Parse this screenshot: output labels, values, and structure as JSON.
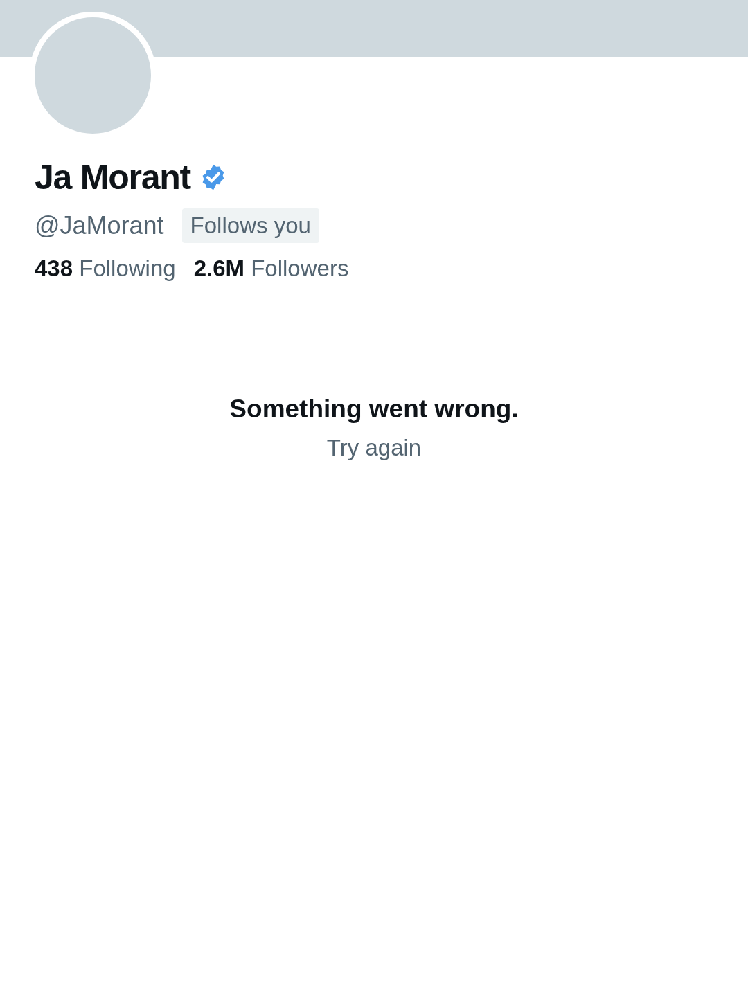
{
  "profile": {
    "name": "Ja Morant",
    "verified": true,
    "handle": "@JaMorant",
    "follows_you": "Follows you",
    "stats": [
      "**438** Following",
      "**2.6M** Followers"
    ]
  },
  "error": {
    "title": "Something went wrong.",
    "action": "Try again"
  }
}
